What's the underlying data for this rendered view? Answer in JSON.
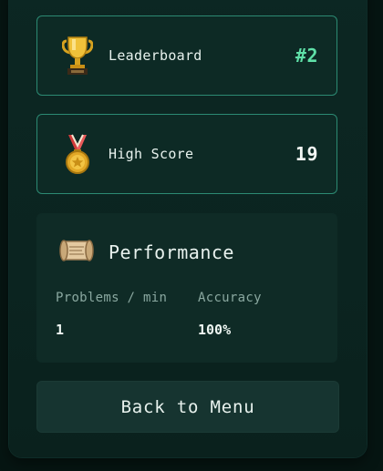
{
  "stats": {
    "leaderboard": {
      "label": "Leaderboard",
      "value": "#2",
      "icon": "trophy-icon",
      "value_color": "#5fe0a8"
    },
    "high_score": {
      "label": "High Score",
      "value": "19",
      "icon": "medal-icon",
      "value_color": "#f2f7f4"
    }
  },
  "performance": {
    "title": "Performance",
    "icon": "scroll-icon",
    "metrics": [
      {
        "label": "Problems / min",
        "value": "1"
      },
      {
        "label": "Accuracy",
        "value": "100%"
      }
    ]
  },
  "back_button": {
    "label": "Back to Menu"
  },
  "colors": {
    "accent": "#5fe0a8",
    "card_border": "#2c8a73",
    "panel_bg": "#0c2723",
    "page_bg": "#061512"
  }
}
